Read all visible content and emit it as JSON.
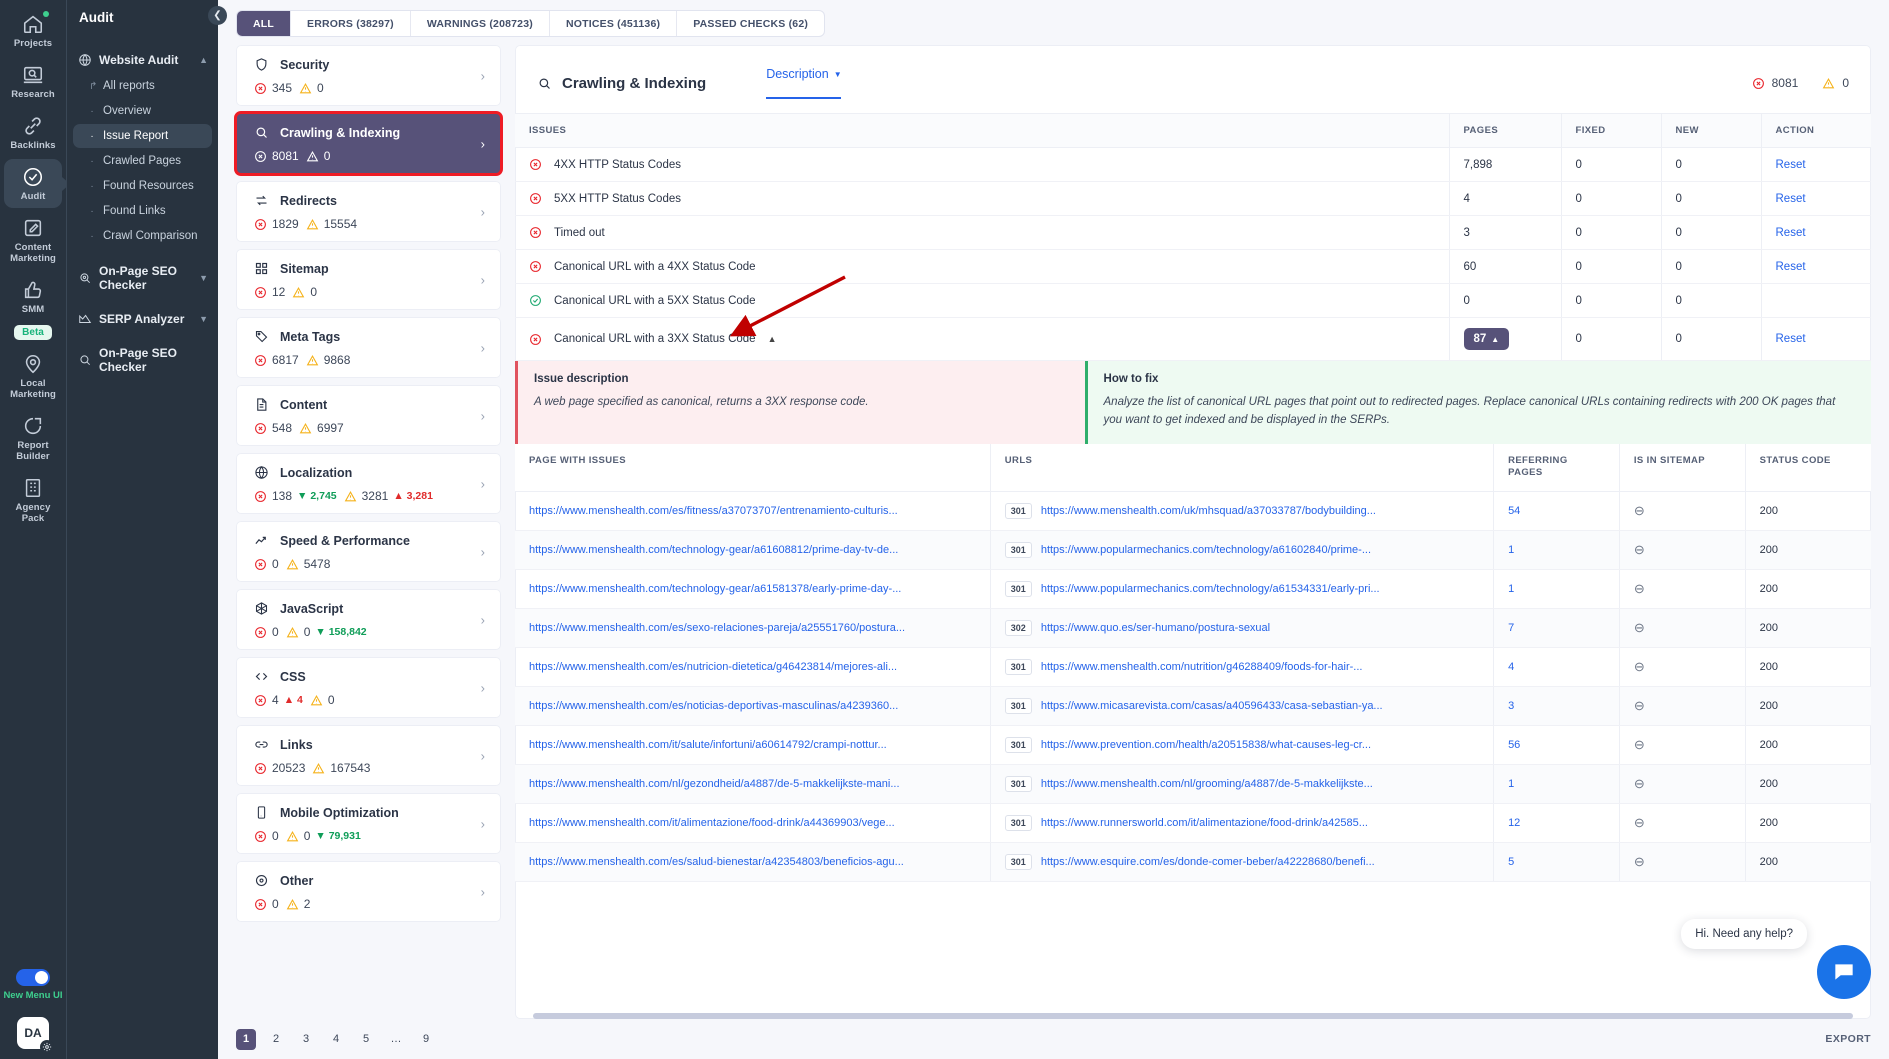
{
  "rail": {
    "items": [
      {
        "label": "Projects",
        "icon": "home-icon",
        "dot": true
      },
      {
        "label": "Research",
        "icon": "research-icon"
      },
      {
        "label": "Backlinks",
        "icon": "link-icon"
      },
      {
        "label": "Audit",
        "icon": "check-circle-icon",
        "active": true
      },
      {
        "label": "Content\nMarketing",
        "icon": "edit-icon"
      },
      {
        "label": "SMM",
        "icon": "thumbs-up-icon",
        "badge": "Beta"
      },
      {
        "label": "Local\nMarketing",
        "icon": "pin-icon"
      },
      {
        "label": "Report\nBuilder",
        "icon": "pie-chart-icon"
      },
      {
        "label": "Agency\nPack",
        "icon": "building-icon"
      }
    ],
    "toggle_label": "New Menu UI",
    "avatar_initials": "DA"
  },
  "nav": {
    "title": "Audit",
    "groups": [
      {
        "label": "Website Audit",
        "icon": "globe-icon",
        "expanded": true,
        "items": [
          {
            "label": "All reports",
            "bullet": "arrow"
          },
          {
            "label": "Overview",
            "bullet": "dot"
          },
          {
            "label": "Issue Report",
            "bullet": "dot",
            "active": true
          },
          {
            "label": "Crawled Pages",
            "bullet": "dot"
          },
          {
            "label": "Found Resources",
            "bullet": "dot"
          },
          {
            "label": "Found Links",
            "bullet": "dot"
          },
          {
            "label": "Crawl Comparison",
            "bullet": "dot"
          }
        ]
      },
      {
        "label": "On-Page SEO Checker",
        "icon": "target-icon",
        "expanded": false,
        "items": []
      },
      {
        "label": "SERP Analyzer",
        "icon": "chart-icon",
        "expanded": false,
        "items": []
      },
      {
        "label": "On-Page SEO Checker",
        "icon": "search-icon",
        "expanded": null,
        "items": []
      }
    ]
  },
  "tabs": [
    {
      "label": "ALL",
      "active": true
    },
    {
      "label": "ERRORS (38297)",
      "active": false
    },
    {
      "label": "WARNINGS (208723)",
      "active": false
    },
    {
      "label": "NOTICES (451136)",
      "active": false
    },
    {
      "label": "PASSED CHECKS (62)",
      "active": false
    }
  ],
  "categories": [
    {
      "name": "Security",
      "icon": "shield-icon",
      "errors": "345",
      "warnings": "0",
      "selected": false
    },
    {
      "name": "Crawling & Indexing",
      "icon": "search-icon",
      "errors": "8081",
      "warnings": "0",
      "selected": true
    },
    {
      "name": "Redirects",
      "icon": "redirect-icon",
      "errors": "1829",
      "warnings": "15554",
      "selected": false
    },
    {
      "name": "Sitemap",
      "icon": "grid-icon",
      "errors": "12",
      "warnings": "0",
      "selected": false
    },
    {
      "name": "Meta Tags",
      "icon": "tag-icon",
      "errors": "6817",
      "warnings": "9868",
      "selected": false
    },
    {
      "name": "Content",
      "icon": "document-icon",
      "errors": "548",
      "warnings": "6997",
      "selected": false
    },
    {
      "name": "Localization",
      "icon": "globe-icon",
      "errors": "138",
      "errors_delta": "2,745",
      "errors_delta_dir": "down",
      "warnings": "3281",
      "warnings_delta": "3,281",
      "warnings_delta_dir": "up",
      "selected": false
    },
    {
      "name": "Speed & Performance",
      "icon": "trend-icon",
      "errors": "0",
      "warnings": "5478",
      "selected": false
    },
    {
      "name": "JavaScript",
      "icon": "js-icon",
      "errors": "0",
      "warnings": "0",
      "warnings_delta": "158,842",
      "warnings_delta_dir": "down",
      "selected": false
    },
    {
      "name": "CSS",
      "icon": "code-icon",
      "errors": "4",
      "errors_delta": "4",
      "errors_delta_dir": "up",
      "warnings": "0",
      "selected": false
    },
    {
      "name": "Links",
      "icon": "chain-icon",
      "errors": "20523",
      "warnings": "167543",
      "selected": false
    },
    {
      "name": "Mobile Optimization",
      "icon": "mobile-icon",
      "errors": "0",
      "warnings": "0",
      "warnings_delta": "79,931",
      "warnings_delta_dir": "down",
      "selected": false
    },
    {
      "name": "Other",
      "icon": "circle-dot-icon",
      "errors": "0",
      "warnings": "2",
      "selected": false
    }
  ],
  "panel": {
    "title": "Crawling & Indexing",
    "description_tab": "Description",
    "errors_total": "8081",
    "warnings_total": "0",
    "issues_columns": [
      "ISSUES",
      "PAGES",
      "FIXED",
      "NEW",
      "ACTION"
    ],
    "issues": [
      {
        "status": "error",
        "name": "4XX HTTP Status Codes",
        "pages": "7,898",
        "fixed": "0",
        "new": "0",
        "action": "Reset",
        "expanded": false
      },
      {
        "status": "error",
        "name": "5XX HTTP Status Codes",
        "pages": "4",
        "fixed": "0",
        "new": "0",
        "action": "Reset",
        "expanded": false
      },
      {
        "status": "error",
        "name": "Timed out",
        "pages": "3",
        "fixed": "0",
        "new": "0",
        "action": "Reset",
        "expanded": false
      },
      {
        "status": "error",
        "name": "Canonical URL with a 4XX Status Code",
        "pages": "60",
        "fixed": "0",
        "new": "0",
        "action": "Reset",
        "expanded": false
      },
      {
        "status": "ok",
        "name": "Canonical URL with a 5XX Status Code",
        "pages": "0",
        "fixed": "0",
        "new": "0",
        "action": "",
        "expanded": false
      },
      {
        "status": "error",
        "name": "Canonical URL with a 3XX Status Code",
        "pages": "87",
        "fixed": "0",
        "new": "0",
        "action": "Reset",
        "expanded": true
      }
    ],
    "issue_description_title": "Issue description",
    "issue_description_text": "A web page specified as canonical, returns a 3XX response code.",
    "how_to_fix_title": "How to fix",
    "how_to_fix_text": "Analyze the list of canonical URL pages that point out to redirected pages. Replace canonical URLs containing redirects with 200 OK pages that you want to get indexed and be displayed in the SERPs.",
    "urls_columns": [
      "PAGE WITH ISSUES",
      "URLS",
      "REFERRING PAGES",
      "IS IN SITEMAP",
      "STATUS CODE"
    ],
    "url_rows": [
      {
        "page": "https://www.menshealth.com/es/fitness/a37073707/entrenamiento-culturis...",
        "code": "301",
        "url": "https://www.menshealth.com/uk/mhsquad/a37033787/bodybuilding...",
        "referring": "54",
        "sitemap": "—",
        "status": "200"
      },
      {
        "page": "https://www.menshealth.com/technology-gear/a61608812/prime-day-tv-de...",
        "code": "301",
        "url": "https://www.popularmechanics.com/technology/a61602840/prime-...",
        "referring": "1",
        "sitemap": "—",
        "status": "200"
      },
      {
        "page": "https://www.menshealth.com/technology-gear/a61581378/early-prime-day-...",
        "code": "301",
        "url": "https://www.popularmechanics.com/technology/a61534331/early-pri...",
        "referring": "1",
        "sitemap": "—",
        "status": "200"
      },
      {
        "page": "https://www.menshealth.com/es/sexo-relaciones-pareja/a25551760/postura...",
        "code": "302",
        "url": "https://www.quo.es/ser-humano/postura-sexual",
        "referring": "7",
        "sitemap": "—",
        "status": "200"
      },
      {
        "page": "https://www.menshealth.com/es/nutricion-dietetica/g46423814/mejores-ali...",
        "code": "301",
        "url": "https://www.menshealth.com/nutrition/g46288409/foods-for-hair-...",
        "referring": "4",
        "sitemap": "—",
        "status": "200"
      },
      {
        "page": "https://www.menshealth.com/es/noticias-deportivas-masculinas/a4239360...",
        "code": "301",
        "url": "https://www.micasarevista.com/casas/a40596433/casa-sebastian-ya...",
        "referring": "3",
        "sitemap": "—",
        "status": "200"
      },
      {
        "page": "https://www.menshealth.com/it/salute/infortuni/a60614792/crampi-nottur...",
        "code": "301",
        "url": "https://www.prevention.com/health/a20515838/what-causes-leg-cr...",
        "referring": "56",
        "sitemap": "—",
        "status": "200"
      },
      {
        "page": "https://www.menshealth.com/nl/gezondheid/a4887/de-5-makkelijkste-mani...",
        "code": "301",
        "url": "https://www.menshealth.com/nl/grooming/a4887/de-5-makkelijkste...",
        "referring": "1",
        "sitemap": "—",
        "status": "200"
      },
      {
        "page": "https://www.menshealth.com/it/alimentazione/food-drink/a44369903/vege...",
        "code": "301",
        "url": "https://www.runnersworld.com/it/alimentazione/food-drink/a42585...",
        "referring": "12",
        "sitemap": "—",
        "status": "200"
      },
      {
        "page": "https://www.menshealth.com/es/salud-bienestar/a42354803/beneficios-agu...",
        "code": "301",
        "url": "https://www.esquire.com/es/donde-comer-beber/a42228680/benefi...",
        "referring": "5",
        "sitemap": "—",
        "status": "200"
      }
    ]
  },
  "footer": {
    "pages": [
      "1",
      "2",
      "3",
      "4",
      "5",
      "…",
      "9"
    ],
    "current_page": "1",
    "export_label": "EXPORT"
  },
  "chat": {
    "message": "Hi. Need any help?"
  }
}
